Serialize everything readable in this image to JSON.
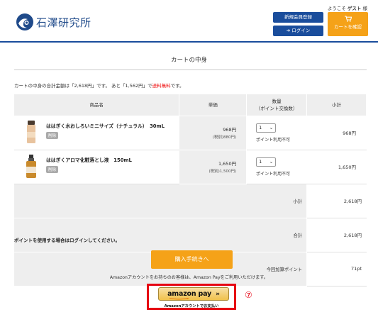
{
  "header": {
    "logo_text": "石澤研究所",
    "welcome_prefix": "ようこそ",
    "welcome_name": "ゲスト",
    "welcome_suffix": "様",
    "register_label": "新規会員登録",
    "login_label": "ログイン",
    "cart_label": "カートを確認",
    "brand_blue": "#1a4d9c",
    "accent_orange": "#f5a218"
  },
  "page": {
    "title": "カートの中身",
    "summary_before": "カートの中身の合計金額は「2,618円」です。 あと「1,562円」で",
    "summary_highlight": "送料無料",
    "summary_after": "です。"
  },
  "table": {
    "headers": {
      "product": "商品名",
      "price": "単価",
      "qty_line1": "数量",
      "qty_line2": "（ポイント交換数）",
      "subtotal": "小計"
    },
    "items": [
      {
        "name": "ははぎく水おしろいミニサイズ（ナチュラル）　30mL",
        "badge": "削除",
        "price": "968円",
        "price_tax": "(税別)880円)",
        "qty": "1",
        "qty_note": "ポイント利用不可",
        "subtotal": "968円"
      },
      {
        "name": "ははぎくアロマ化粧落とし液　150mL",
        "badge": "削除",
        "price": "1,650円",
        "price_tax": "(税別)1,500円)",
        "qty": "1",
        "qty_note": "ポイント利用不可",
        "subtotal": "1,650円"
      }
    ],
    "summary": {
      "subtotal_label": "小計",
      "subtotal_value": "2,618円",
      "total_label": "合計",
      "total_value": "2,618円",
      "points_label": "今回加算ポイント",
      "points_value": "71pt"
    }
  },
  "footer": {
    "points_note": "ポイントを使用する場合はログインしてください。",
    "checkout_label": "購入手続きへ",
    "amazon_note": "Amazonアカウントをお持ちのお客様は、Amazon Payをご利用いただけます。",
    "amazon_button_text": "amazon pay",
    "amazon_chevrons": "»",
    "amazon_sub": "Amazonアカウントでお支払い",
    "marker": "⑦",
    "highlight_color": "#e60012"
  }
}
